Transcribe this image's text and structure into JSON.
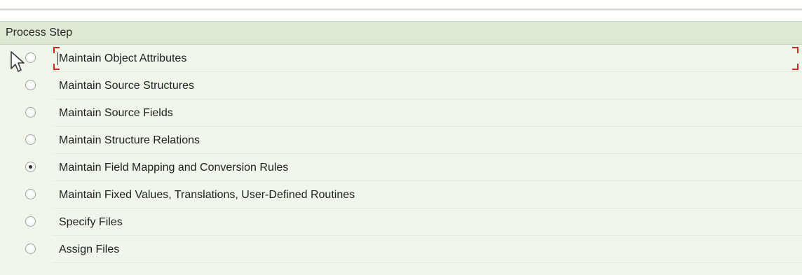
{
  "panel": {
    "header": "Process Step",
    "steps": [
      {
        "label": "Maintain Object Attributes",
        "selected": false,
        "focused": true
      },
      {
        "label": "Maintain Source Structures",
        "selected": false
      },
      {
        "label": "Maintain Source Fields",
        "selected": false
      },
      {
        "label": "Maintain Structure Relations",
        "selected": false
      },
      {
        "label": "Maintain Field Mapping and Conversion Rules",
        "selected": true
      },
      {
        "label": "Maintain Fixed Values, Translations, User-Defined Routines",
        "selected": false
      },
      {
        "label": "Specify Files",
        "selected": false
      },
      {
        "label": "Assign Files",
        "selected": false
      }
    ]
  },
  "colors": {
    "panel_bg": "#eff7ea",
    "header_bg": "#dde9d5",
    "focus_corners": "#cc2a1f"
  },
  "icons": {
    "cursor": "mouse-pointer-icon"
  }
}
